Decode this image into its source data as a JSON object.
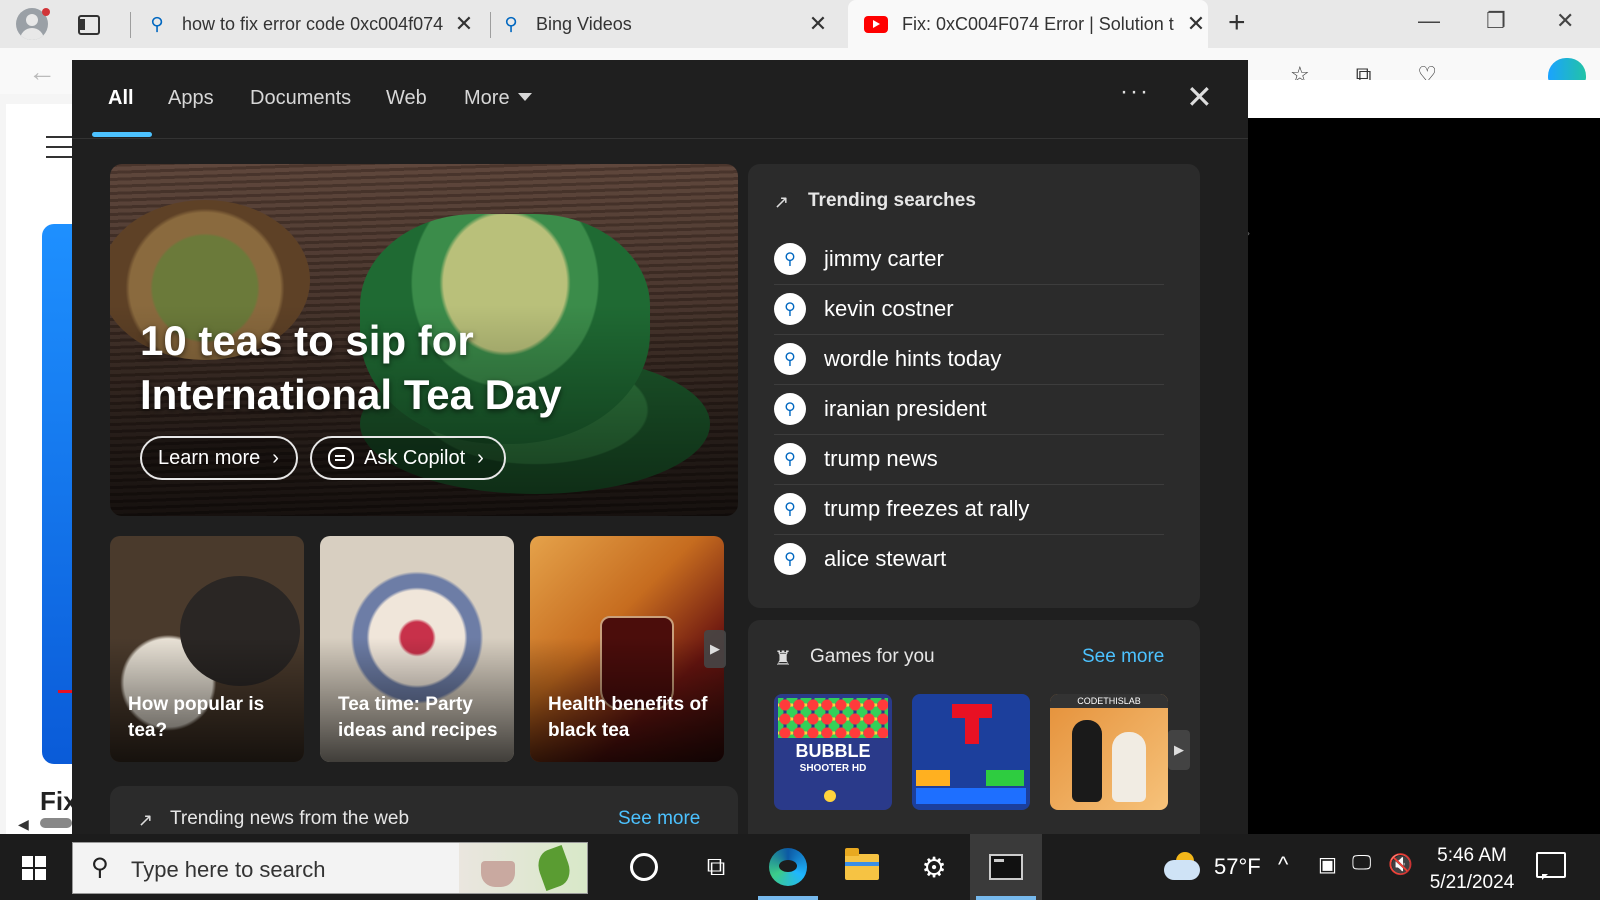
{
  "browser": {
    "tabs": [
      {
        "title": "how to fix error code 0xc004f074",
        "icon": "search-icon",
        "close": "✕"
      },
      {
        "title": "Bing Videos",
        "icon": "search-icon",
        "close": "✕"
      },
      {
        "title": "Fix: 0xC004F074 Error | Solution t",
        "icon": "youtube-icon",
        "close": "✕",
        "active": true
      }
    ],
    "new_tab": "+",
    "window": {
      "minimize": "—",
      "restore": "❐",
      "close": "✕"
    },
    "back": "←",
    "page_fragment": "Fix"
  },
  "flyout": {
    "nav": [
      {
        "label": "All",
        "active": true
      },
      {
        "label": "Apps"
      },
      {
        "label": "Documents"
      },
      {
        "label": "Web"
      },
      {
        "label": "More"
      }
    ],
    "dots": "···",
    "close": "✕",
    "hero": {
      "title": "10 teas to sip for International Tea Day",
      "learn_more": "Learn more",
      "ask_copilot": "Ask Copilot"
    },
    "cards": [
      {
        "title": "How popular is tea?"
      },
      {
        "title": "Tea time: Party ideas and recipes"
      },
      {
        "title": "Health benefits of black tea"
      }
    ],
    "trending_news": {
      "title": "Trending news from the web",
      "see_more": "See more"
    },
    "trending_searches": {
      "title": "Trending searches",
      "items": [
        "jimmy carter",
        "kevin costner",
        "wordle hints today",
        "iranian president",
        "trump news",
        "trump freezes at rally",
        "alice stewart"
      ]
    },
    "games": {
      "title": "Games for you",
      "see_more": "See more",
      "tiles": [
        {
          "name": "BUBBLE",
          "sub": "SHOOTER HD"
        },
        {
          "name": ""
        },
        {
          "label": "CODETHISLAB"
        }
      ]
    }
  },
  "taskbar": {
    "search_placeholder": "Type here to search",
    "temperature": "57°F",
    "time": "5:46 AM",
    "date": "5/21/2024"
  },
  "colors": {
    "accent": "#4cc2ff",
    "flyout_bg": "#1f1f1f",
    "panel_bg": "#2b2b2b",
    "taskbar_bg": "#1c1c1c"
  }
}
